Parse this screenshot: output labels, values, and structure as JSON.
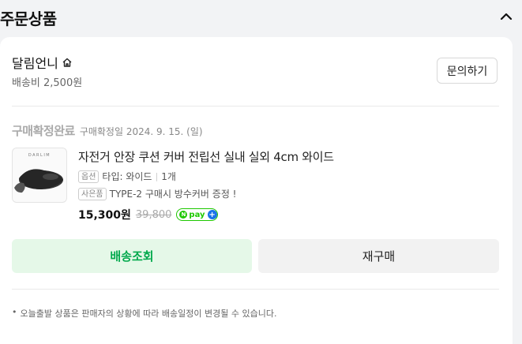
{
  "section": {
    "title": "주문상품",
    "collapse_icon": "chevron-up-icon"
  },
  "store": {
    "name": "달림언니",
    "home_icon": "home-icon",
    "shipping_fee": "배송비 2,500원",
    "inquiry_label": "문의하기"
  },
  "order": {
    "status": "구매확정완료",
    "confirm_date": "구매확정일 2024. 9. 15. (일)"
  },
  "product": {
    "name": "자전거 안장 쿠션 커버 전립선 실내 실외 4cm 와이드",
    "option_tag": "옵션",
    "option_value": "타입: 와이드",
    "quantity": "1개",
    "gift_tag": "사은품",
    "gift_value": "TYPE-2 구매시 방수커버 증정 !",
    "price": "15,300원",
    "original_price": "39,800",
    "npay_label": "pay",
    "npay_plus": "+",
    "thumb_brand": "DARLIM"
  },
  "actions": {
    "track_label": "배송조회",
    "reorder_label": "재구매"
  },
  "notice": {
    "bullet": "•",
    "text": "오늘출발 상품은 판매자의 상황에 따라 배송일정이 변경될 수 있습니다."
  },
  "colors": {
    "accent_green": "#03a94d",
    "track_bg": "#e5f8e8",
    "npay_green": "#1ec800"
  }
}
